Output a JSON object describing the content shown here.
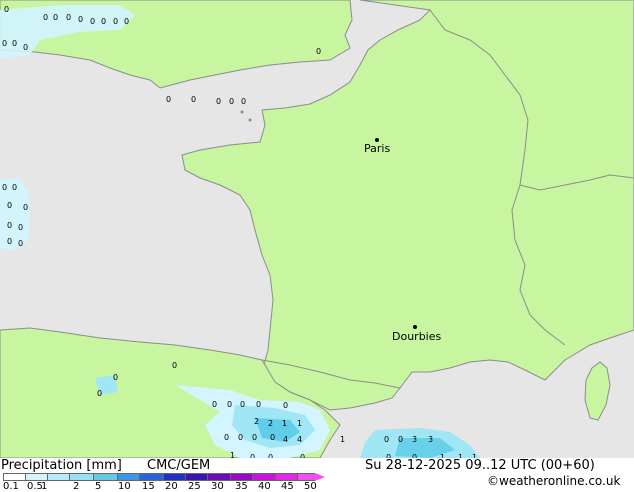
{
  "map": {
    "cities": [
      {
        "name": "Paris"
      },
      {
        "name": "Dourbies"
      }
    ],
    "colors": {
      "sea": "#e6e6e6",
      "land": "#c8f5a0",
      "border": "#8c8c8c",
      "precip_light": "#d2f5ff",
      "precip_mid": "#a0e6f5",
      "precip_heavy": "#50c8e6"
    },
    "precip_values": [
      "0",
      "0",
      "0",
      "0",
      "0",
      "0",
      "0",
      "0",
      "0",
      "0",
      "0",
      "0",
      "0",
      "0",
      "0",
      "0",
      "0",
      "0",
      "0",
      "0",
      "0",
      "0",
      "0",
      "0",
      "0",
      "0",
      "0",
      "0",
      "0",
      "0",
      "0",
      "0",
      "0",
      "0",
      "2",
      "2",
      "1",
      "1",
      "0",
      "0",
      "0",
      "0",
      "4",
      "4",
      "1",
      "0",
      "0",
      "3",
      "3",
      "1",
      "0",
      "0",
      "0",
      "0",
      "0",
      "1",
      "1",
      "1"
    ]
  },
  "footer": {
    "title": "Precipitation [mm]",
    "model": "CMC/GEM",
    "datetime": "Su 28-12-2025 09..12 UTC (00+60)",
    "credit": "©weatheronline.co.uk",
    "scale_labels": [
      "0.1",
      "0.5",
      "1",
      "2",
      "5",
      "10",
      "15",
      "20",
      "25",
      "30",
      "35",
      "40",
      "45",
      "50"
    ],
    "scale_colors": [
      "#ffffff",
      "#d2f5ff",
      "#b4ebff",
      "#96e1f5",
      "#64c8e6",
      "#3c96e6",
      "#2864dc",
      "#1e32c8",
      "#3c14b4",
      "#6e0ab4",
      "#960ac8",
      "#c814dc",
      "#e628e6",
      "#f050f0"
    ]
  }
}
